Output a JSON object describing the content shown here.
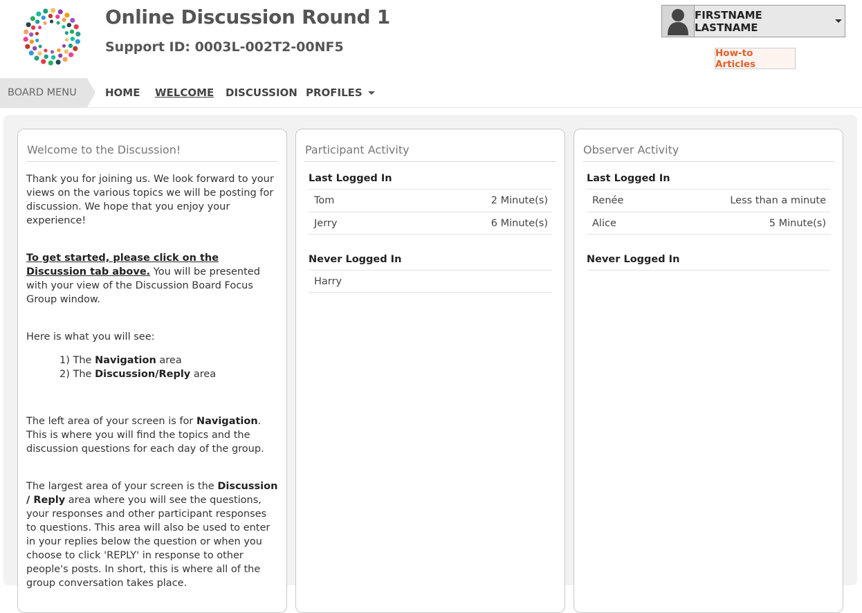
{
  "header": {
    "title": "Online Discussion Round 1",
    "support_id": "Support ID: 0003L-002T2-00NF5",
    "user_name": "FIRSTNAME LASTNAME",
    "howto_label": "How-to Articles"
  },
  "nav": {
    "board_menu": "BOARD MENU",
    "items": [
      "HOME",
      "WELCOME",
      "DISCUSSION",
      "PROFILES"
    ],
    "active": "WELCOME"
  },
  "welcome": {
    "title": "Welcome to the Discussion!",
    "p1": "Thank you for joining us. We look forward to your views on the various topics we will be posting for discussion. We hope that you enjoy your experience!",
    "p2_link": "To get started, please click on the Discussion tab above.",
    "p2_rest": " You will be presented with your view of the Discussion Board Focus Group window.",
    "p3": "Here is what you will see:",
    "list1_pre": "1) The ",
    "list1_bold": "Navigation",
    "list1_post": " area",
    "list2_pre": "2) The ",
    "list2_bold": "Discussion/Reply",
    "list2_post": " area",
    "p4_pre": "The left area of your screen is for ",
    "p4_bold": "Navigation",
    "p4_post": ". This is where you will find the topics and the discussion questions for each day of the group.",
    "p5_pre": "The largest area of your screen is the ",
    "p5_bold": "Discussion / Reply",
    "p5_post": " area where you will see the questions, your responses and other participant responses to questions. This area will also be used to enter in your replies below the question or when you choose to click 'REPLY' in response to other people's posts. In short, this is where all of the group conversation takes place."
  },
  "participant": {
    "title": "Participant Activity",
    "last_logged_in": "Last Logged In",
    "never_logged_in": "Never Logged In",
    "logged": [
      {
        "name": "Tom",
        "time": "2 Minute(s)"
      },
      {
        "name": "Jerry",
        "time": "6 Minute(s)"
      }
    ],
    "never": [
      "Harry"
    ]
  },
  "observer": {
    "title": "Observer Activity",
    "last_logged_in": "Last Logged In",
    "never_logged_in": "Never Logged In",
    "logged": [
      {
        "name": "Renée",
        "time": "Less than a minute"
      },
      {
        "name": "Alice",
        "time": "5 Minute(s)"
      }
    ]
  },
  "colors": {
    "accent": "#e0602c",
    "title_gray": "#555555",
    "panel_bg": "#f2f2f2"
  },
  "icons": {
    "logo": "dotted-circle-logo-icon",
    "avatar": "user-silhouette-icon",
    "caret": "caret-down-icon"
  }
}
